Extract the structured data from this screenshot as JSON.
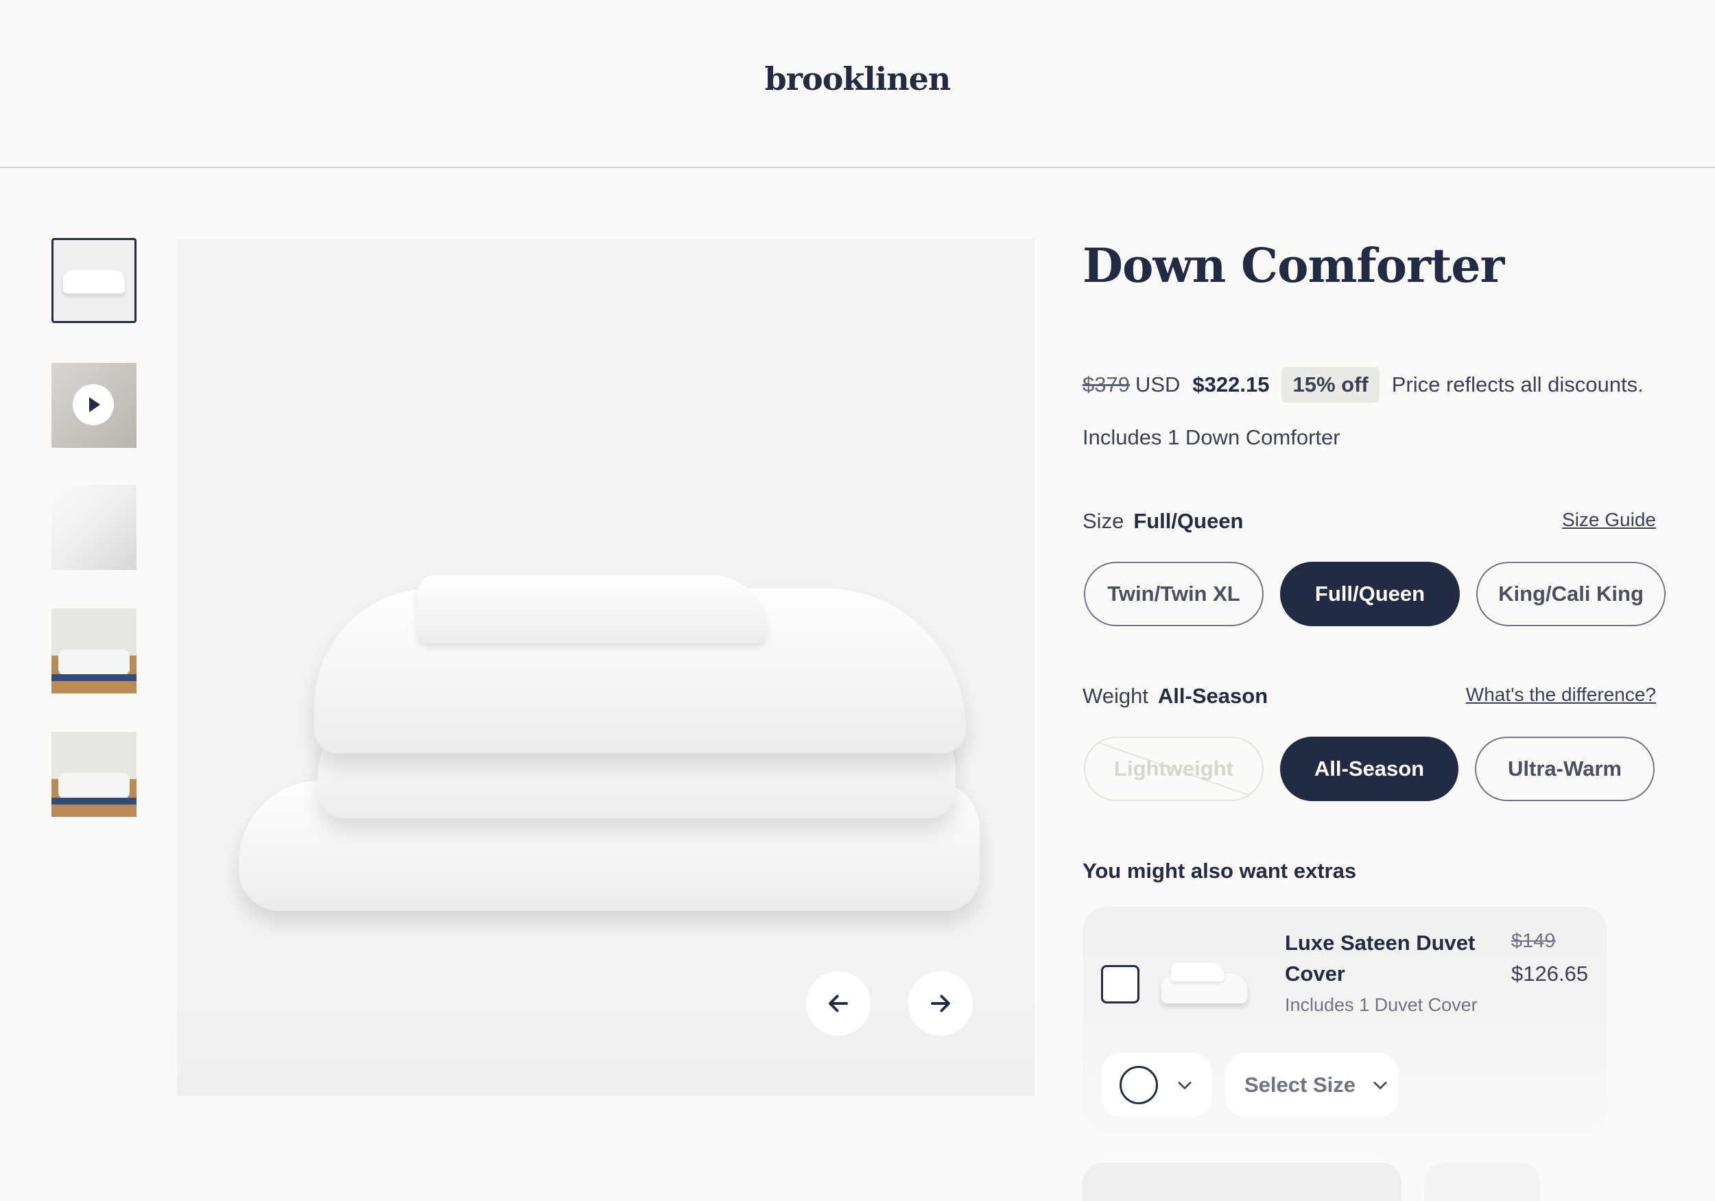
{
  "brand": {
    "logo": "brooklinen"
  },
  "gallery": {
    "thumbnails": [
      {
        "kind": "image",
        "label": "comforter-folded"
      },
      {
        "kind": "video",
        "label": "video"
      },
      {
        "kind": "image",
        "label": "closeup"
      },
      {
        "kind": "image",
        "label": "bedroom-1"
      },
      {
        "kind": "image",
        "label": "bedroom-2"
      }
    ],
    "prev_icon": "arrow-left-icon",
    "next_icon": "arrow-right-icon"
  },
  "product": {
    "title": "Down Comforter",
    "original_price": "$379",
    "currency": "USD",
    "sale_price": "$322.15",
    "discount_badge": "15% off",
    "discount_note": "Price reflects all discounts.",
    "includes": "Includes 1 Down Comforter"
  },
  "size": {
    "label": "Size",
    "selected": "Full/Queen",
    "guide_link": "Size Guide",
    "options": [
      "Twin/Twin XL",
      "Full/Queen",
      "King/Cali King"
    ]
  },
  "weight": {
    "label": "Weight",
    "selected": "All-Season",
    "link": "What's the difference?",
    "options": [
      "Lightweight",
      "All-Season",
      "Ultra-Warm"
    ],
    "disabled": [
      "Lightweight"
    ]
  },
  "extras": {
    "title": "You might also want extras",
    "items": [
      {
        "name": "Luxe Sateen Duvet Cover",
        "includes": "Includes 1 Duvet Cover",
        "original_price": "$149",
        "sale_price": "$126.65",
        "size_placeholder": "Select Size"
      }
    ]
  },
  "colors": {
    "navy": "#222a44",
    "background": "#fcfaf8",
    "badge_bg": "#ebe9e6"
  }
}
